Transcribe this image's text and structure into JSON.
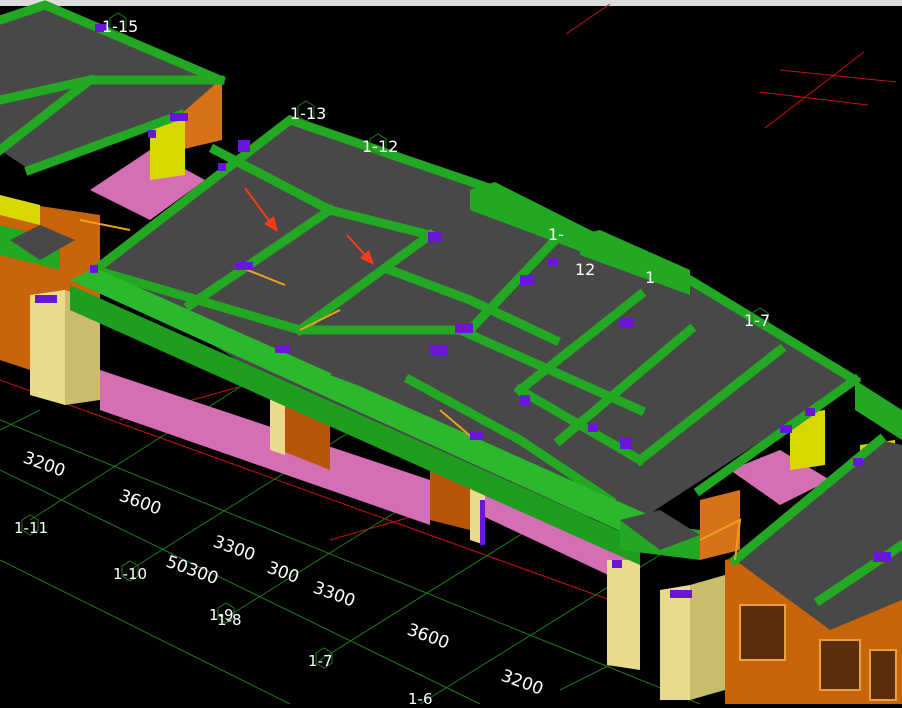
{
  "colors": {
    "background": "#000000",
    "beam": "#22a822",
    "beam_dark": "#138313",
    "slab": "#484848",
    "slab_dark": "#2e2e2e",
    "wall_orange": "#c8640a",
    "wall_orange_dark": "#9c4a05",
    "wall_light": "#e8dc8c",
    "pink_wall": "#d46fb5",
    "column_purple": "#6a16d8",
    "yellow_column": "#d8d800",
    "red_line": "#d81414",
    "grid_green": "#1e7e1e",
    "annotation_arrow": "#ff3a1a"
  },
  "axis_labels": {
    "a1_15": "1-15",
    "a1_13": "1-13",
    "a1_12": "1-12",
    "a1_7_top": "1-7",
    "a1_11": "1-11",
    "a1_10": "1-10",
    "a1_9": "1-9",
    "a1_8": "1-8",
    "a1_7_bottom": "1-7",
    "a1_6": "1-6",
    "partial_a": "1-",
    "partial_b": "1-",
    "partial_c": "1",
    "partial_d": "12"
  },
  "dimensions": {
    "d1": "3200",
    "d2": "3600",
    "d3": "3300",
    "d4": "300",
    "d5": "3300",
    "d6": "3600",
    "d7": "3200",
    "total": "50300"
  }
}
